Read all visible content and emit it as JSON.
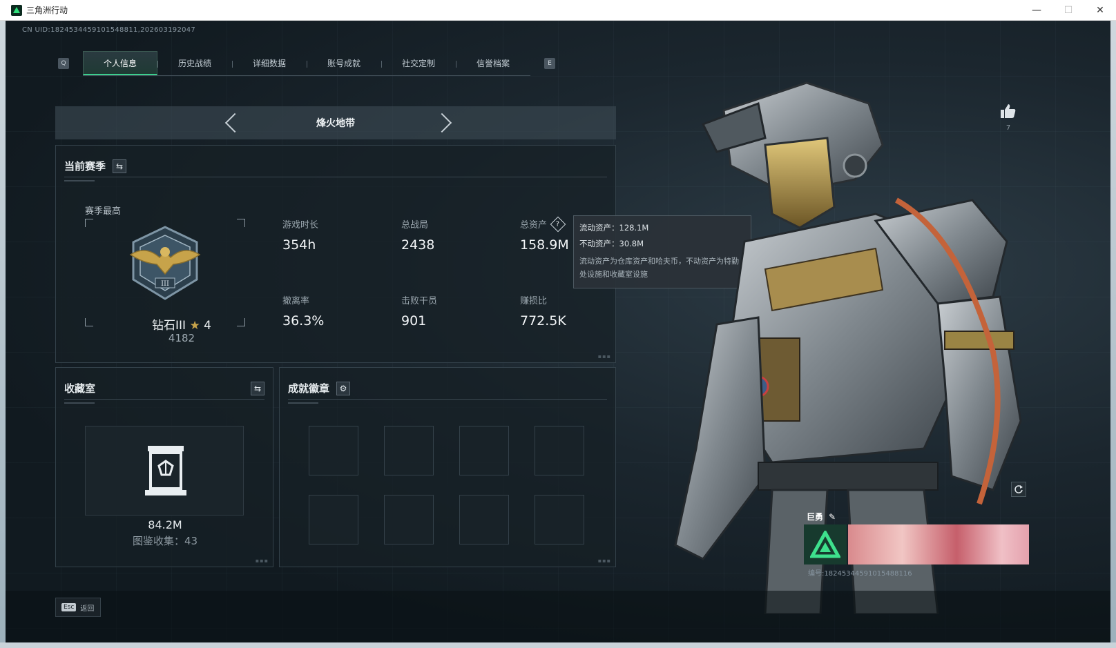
{
  "window": {
    "title": "三角洲行动"
  },
  "uid_line": "CN UID:1824534459101548811⁦,202603192047",
  "tabs": {
    "prev_key": "Q",
    "next_key": "E",
    "items": [
      {
        "label": "个人信息",
        "active": true
      },
      {
        "label": "历史战绩"
      },
      {
        "label": "详细数据"
      },
      {
        "label": "账号成就"
      },
      {
        "label": "社交定制"
      },
      {
        "label": "信誉档案"
      }
    ]
  },
  "mode": {
    "title": "烽火地带"
  },
  "season": {
    "title": "当前赛季",
    "best_label": "赛季最高",
    "rank_name": "钻石III",
    "rank_stars": "4",
    "rank_score": "4182",
    "stats": {
      "play_time": {
        "label": "游戏时长",
        "value": "354h"
      },
      "total_matches": {
        "label": "总战局",
        "value": "2438"
      },
      "total_assets": {
        "label": "总资产",
        "value": "158.9M"
      },
      "extract_rate": {
        "label": "撤离率",
        "value": "36.3%"
      },
      "kills": {
        "label": "击败干员",
        "value": "901"
      },
      "profit_ratio": {
        "label": "赚损比",
        "value": "772.5K"
      }
    }
  },
  "tooltip": {
    "liquid": "流动资产：128.1M",
    "fixed": "不动资产：30.8M",
    "desc": "流动资产为仓库资产和哈夫币，不动资产为特勤处设施和收藏室设施"
  },
  "collection": {
    "title": "收藏室",
    "value": "84.2M",
    "count": "图鉴收集：43"
  },
  "achievements": {
    "title": "成就徽章"
  },
  "profile": {
    "like_count": "7",
    "card_name": "巨勇",
    "card_id": "编号:18245344591015488116"
  },
  "footer": {
    "esc_key": "Esc",
    "esc_label": "返回"
  },
  "colors": {
    "accent": "#3ccf8e",
    "panel_bg": "#162026",
    "gold": "#c7a34a"
  }
}
